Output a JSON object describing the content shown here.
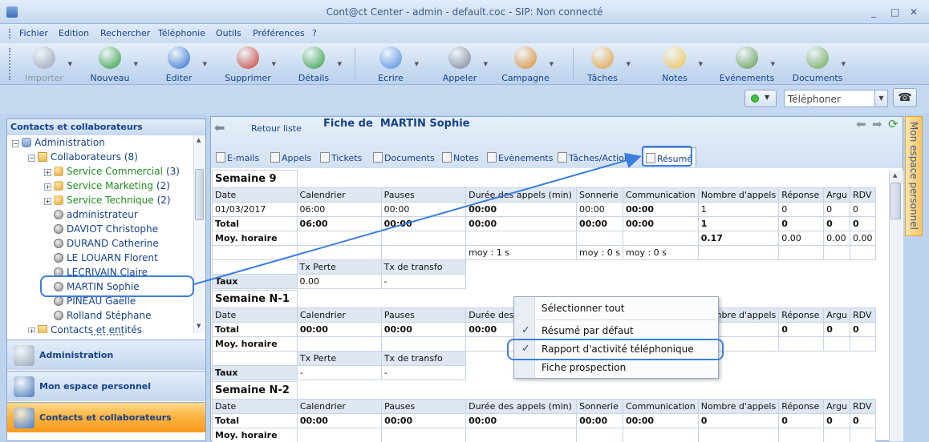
{
  "window": {
    "title": "Cont@ct Center - admin - default.coc - SIP: Non connecté",
    "minimize": "_",
    "maximize": "□",
    "close": "✕"
  },
  "menu": [
    "Fichier",
    "Edition",
    "Rechercher",
    "Téléphonie",
    "Outils",
    "Préférences",
    "?"
  ],
  "ribbon": [
    {
      "label": "Importer",
      "icon": "import-icon",
      "color": "#9aa4b0",
      "disabled": true
    },
    {
      "label": "Nouveau",
      "icon": "new-contact-icon",
      "color": "#2e9f3a"
    },
    {
      "label": "Editer",
      "icon": "edit-icon",
      "color": "#2a6fce"
    },
    {
      "label": "Supprimer",
      "icon": "delete-icon",
      "color": "#cc3b2b"
    },
    {
      "label": "Détails",
      "icon": "details-icon",
      "color": "#2e9f3a"
    },
    {
      "label": "Ecrire",
      "icon": "email-icon",
      "color": "#4a8be0"
    },
    {
      "label": "Appeler",
      "icon": "phone-icon",
      "color": "#7a8594"
    },
    {
      "label": "Campagne",
      "icon": "campaign-icon",
      "color": "#d98c2c"
    },
    {
      "label": "Tâches",
      "icon": "tasks-icon",
      "color": "#e0a23a"
    },
    {
      "label": "Notes",
      "icon": "notes-icon",
      "color": "#f0c24a"
    },
    {
      "label": "Evénements",
      "icon": "events-icon",
      "color": "#5e9b4a"
    },
    {
      "label": "Documents",
      "icon": "documents-icon",
      "color": "#6aa84f"
    }
  ],
  "phone": {
    "select_value": "Téléphoner",
    "status_color": "#3fbf3f"
  },
  "leftpanel": {
    "title": "Contacts et collaborateurs",
    "tree": [
      {
        "label": "Administration",
        "indent": 0,
        "icon": "database-icon",
        "expander": "−"
      },
      {
        "label": "Collaborateurs",
        "count": "(8)",
        "indent": 1,
        "icon": "folder-icon",
        "expander": "−"
      },
      {
        "label": "Service Commercial",
        "count": "(3)",
        "indent": 2,
        "icon": "group-icon",
        "green": true,
        "expander": "+"
      },
      {
        "label": "Service Marketing",
        "count": "(2)",
        "indent": 2,
        "icon": "group-icon",
        "green": true,
        "expander": "+"
      },
      {
        "label": "Service Technique",
        "count": "(2)",
        "indent": 2,
        "icon": "group-icon",
        "green": true,
        "expander": "+"
      },
      {
        "label": "administrateur",
        "indent": 2,
        "icon": "user-icon"
      },
      {
        "label": "DAVIOT Christophe",
        "indent": 2,
        "icon": "user-icon"
      },
      {
        "label": "DURAND Catherine",
        "indent": 2,
        "icon": "user-icon"
      },
      {
        "label": "LE LOUARN Florent",
        "indent": 2,
        "icon": "user-icon"
      },
      {
        "label": "LECRIVAIN Claire",
        "indent": 2,
        "icon": "user-icon"
      },
      {
        "label": "MARTIN Sophie",
        "indent": 2,
        "icon": "user-icon"
      },
      {
        "label": "PINEAU Gaëlle",
        "indent": 2,
        "icon": "user-icon"
      },
      {
        "label": "Rolland Stéphane",
        "indent": 2,
        "icon": "user-icon"
      },
      {
        "label": "Contacts et entités",
        "indent": 1,
        "icon": "folder-icon",
        "expander": "+"
      }
    ],
    "nav": [
      {
        "label": "Administration",
        "icon": "gears-icon",
        "active": false
      },
      {
        "label": "Mon espace personnel",
        "icon": "computer-icon",
        "active": false
      },
      {
        "label": "Contacts et collaborateurs",
        "icon": "contacts-icon",
        "active": true
      }
    ]
  },
  "fiche": {
    "back_label": "Retour liste",
    "title_prefix": "Fiche de",
    "title_name": "MARTIN Sophie",
    "tabs": [
      {
        "label": "E-mails",
        "icon": "email-tab-icon"
      },
      {
        "label": "Appels",
        "icon": "calls-tab-icon"
      },
      {
        "label": "Tickets",
        "icon": "tickets-tab-icon"
      },
      {
        "label": "Documents",
        "icon": "documents-tab-icon"
      },
      {
        "label": "Notes",
        "icon": "notes-tab-icon"
      },
      {
        "label": "Evènements",
        "icon": "events-tab-icon"
      },
      {
        "label": "Tâches/Actions",
        "icon": "tasks-tab-icon"
      },
      {
        "label": "Résumé",
        "icon": "summary-tab-icon",
        "selected": true
      }
    ]
  },
  "weeks": [
    {
      "title": "Semaine 9",
      "headers": [
        "Date",
        "Calendrier",
        "Pauses",
        "Durée des appels (min)",
        "Sonnerie",
        "Communication",
        "Nombre d'appels",
        "Réponse",
        "Argu",
        "RDV"
      ],
      "rows": [
        {
          "bold": false,
          "cells": [
            "01/03/2017",
            "06:00",
            "00:00",
            "00:00",
            "00:00",
            "00:00",
            "1",
            "0",
            "0",
            "0"
          ],
          "boldcols": [
            3,
            5
          ]
        },
        {
          "bold": true,
          "cells": [
            "Total",
            "06:00",
            "00:00",
            "00:00",
            "00:00",
            "00:00",
            "1",
            "0",
            "0",
            "0"
          ]
        },
        {
          "bold": false,
          "cells": [
            "Moy. horaire",
            "",
            "",
            "",
            "",
            "",
            "0.17",
            "0.00",
            "0.00",
            "0.00"
          ],
          "boldcols": [
            0,
            6
          ]
        },
        {
          "bold": false,
          "cells": [
            "",
            "",
            "",
            "moy : 1 s",
            "moy : 0 s",
            "moy : 0 s",
            "",
            "",
            "",
            ""
          ]
        }
      ],
      "rate_headers": [
        "Tx Perte",
        "Tx de transfo"
      ],
      "rate_label": "Taux",
      "rate_values": [
        "0.00",
        "-"
      ]
    },
    {
      "title": "Semaine N-1",
      "headers": [
        "Date",
        "Calendrier",
        "Pauses",
        "Durée des appels (min)",
        "Sonnerie",
        "Communication",
        "Nombre d'appels",
        "Réponse",
        "Argu",
        "RDV"
      ],
      "rows": [
        {
          "bold": true,
          "cells": [
            "Total",
            "00:00",
            "00:00",
            "00:00",
            "00:00",
            "00:00",
            "0",
            "0",
            "0",
            "0"
          ]
        },
        {
          "bold": false,
          "cells": [
            "Moy. horaire",
            "",
            "",
            "",
            "",
            "",
            "",
            "",
            "",
            ""
          ],
          "boldcols": [
            0
          ]
        }
      ],
      "rate_headers": [
        "Tx Perte",
        "Tx de transfo"
      ],
      "rate_label": "Taux",
      "rate_values": [
        "-",
        "-"
      ]
    },
    {
      "title": "Semaine N-2",
      "headers": [
        "Date",
        "Calendrier",
        "Pauses",
        "Durée des appels (min)",
        "Sonnerie",
        "Communication",
        "Nombre d'appels",
        "Réponse",
        "Argu",
        "RDV"
      ],
      "rows": [
        {
          "bold": true,
          "cells": [
            "Total",
            "00:00",
            "00:00",
            "00:00",
            "00:00",
            "00:00",
            "0",
            "0",
            "0",
            "0"
          ]
        },
        {
          "bold": false,
          "cells": [
            "Moy. horaire",
            "",
            "",
            "",
            "",
            "",
            "",
            "",
            "",
            ""
          ],
          "boldcols": [
            0
          ]
        }
      ]
    }
  ],
  "context_menu": [
    {
      "label": "Sélectionner tout",
      "checked": false
    },
    {
      "label": "Résumé par défaut",
      "checked": true
    },
    {
      "label": "Rapport d'activité téléphonique",
      "checked": true
    },
    {
      "label": "Fiche prospection",
      "checked": false
    }
  ],
  "right_panel": {
    "label": "Mon espace personnel"
  }
}
